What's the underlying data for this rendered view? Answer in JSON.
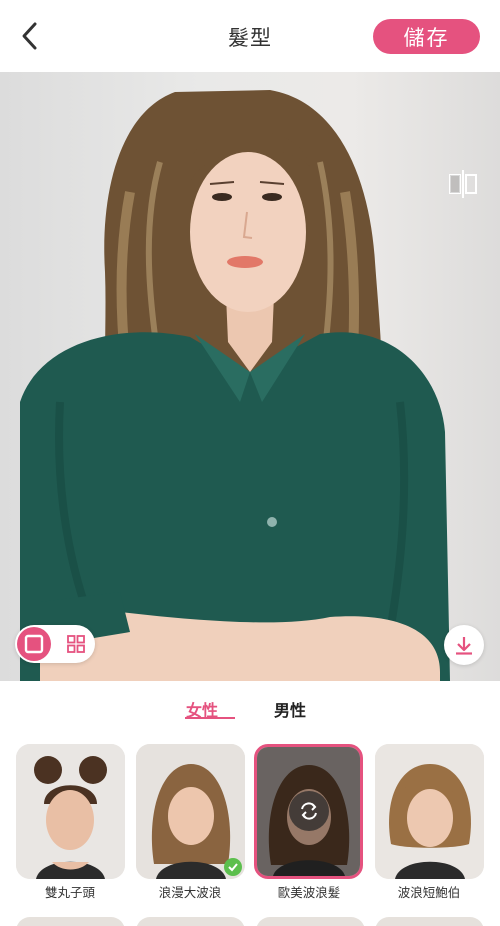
{
  "header": {
    "title": "髮型",
    "save_label": "儲存"
  },
  "tabs": [
    {
      "label": "女性",
      "active": true
    },
    {
      "label": "男性",
      "active": false
    }
  ],
  "styles": [
    {
      "label": "雙丸子頭",
      "selected": false,
      "applied": false
    },
    {
      "label": "浪漫大波浪",
      "selected": false,
      "applied": true
    },
    {
      "label": "歐美波浪髮",
      "selected": true,
      "applied": false
    },
    {
      "label": "波浪短鮑伯",
      "selected": false,
      "applied": false
    }
  ],
  "colors": {
    "accent": "#e5527f",
    "check": "#5cbf4d",
    "shirt": "#1f5a50",
    "hair": "#7a5a38"
  },
  "icons": [
    "back-icon",
    "compare-icon",
    "single-view-icon",
    "grid-view-icon",
    "download-icon",
    "check-icon",
    "refresh-icon"
  ]
}
